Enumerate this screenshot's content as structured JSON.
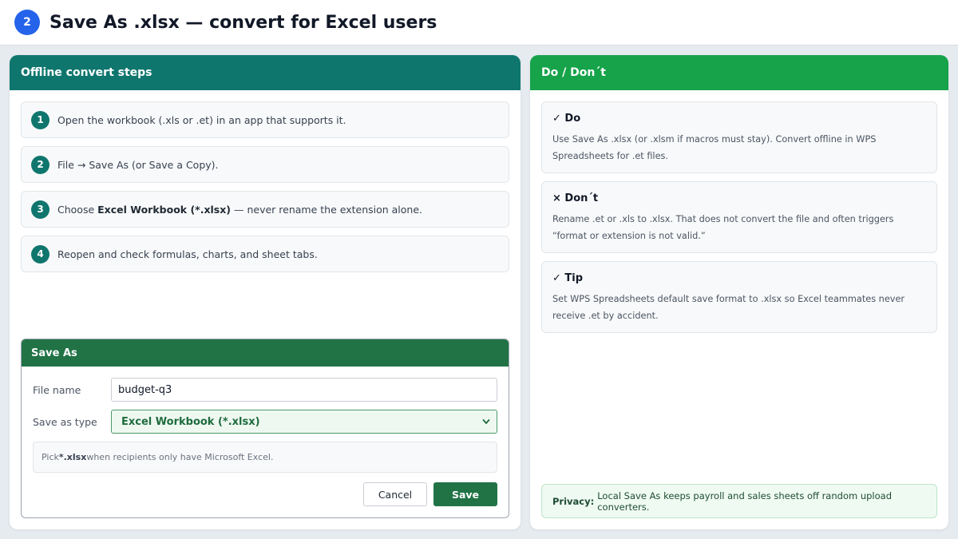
{
  "header": {
    "step_number": "2",
    "title": "Save As .xlsx — convert for Excel users"
  },
  "left_panel": {
    "title": "Offline convert steps",
    "steps": [
      {
        "num": "1",
        "before": "Open the workbook (.xls or .et) in an app that supports it.",
        "bold": "",
        "after": ""
      },
      {
        "num": "2",
        "before": "File → Save As (or Save a Copy).",
        "bold": "",
        "after": ""
      },
      {
        "num": "3",
        "before": "Choose ",
        "bold": "Excel Workbook (*.xlsx)",
        "after": " — never rename the extension alone."
      },
      {
        "num": "4",
        "before": "Reopen and check formulas, charts, and sheet tabs.",
        "bold": "",
        "after": ""
      }
    ]
  },
  "dialog": {
    "title": "Save As",
    "file_name_label": "File name",
    "file_name_value": "budget-q3",
    "type_label": "Save as type",
    "type_value": "Excel Workbook (*.xlsx)",
    "hint_before": "Pick ",
    "hint_bold": "*.xlsx",
    "hint_after": " when recipients only have Microsoft Excel.",
    "cancel_label": "Cancel",
    "save_label": "Save"
  },
  "right_panel": {
    "title": "Do / Don´t",
    "cards": [
      {
        "title": "✓ Do",
        "text": "Use Save As .xlsx (or .xlsm if macros must stay). Convert offline in WPS Spreadsheets for .et files."
      },
      {
        "title": "× Don´t",
        "text": "Rename .et or .xls to .xlsx. That does not convert the file and often triggers “format or extension is not valid.”"
      },
      {
        "title": "✓ Tip",
        "text": "Set WPS Spreadsheets default save format to .xlsx so Excel teammates never receive .et by accident."
      }
    ],
    "privacy_label": "Privacy:",
    "privacy_text": "Local Save As keeps payroll and sales sheets off random upload converters."
  },
  "colors": {
    "accent_blue": "#2563eb",
    "teal": "#0f766e",
    "green": "#16a34a",
    "excel_green": "#217346"
  }
}
